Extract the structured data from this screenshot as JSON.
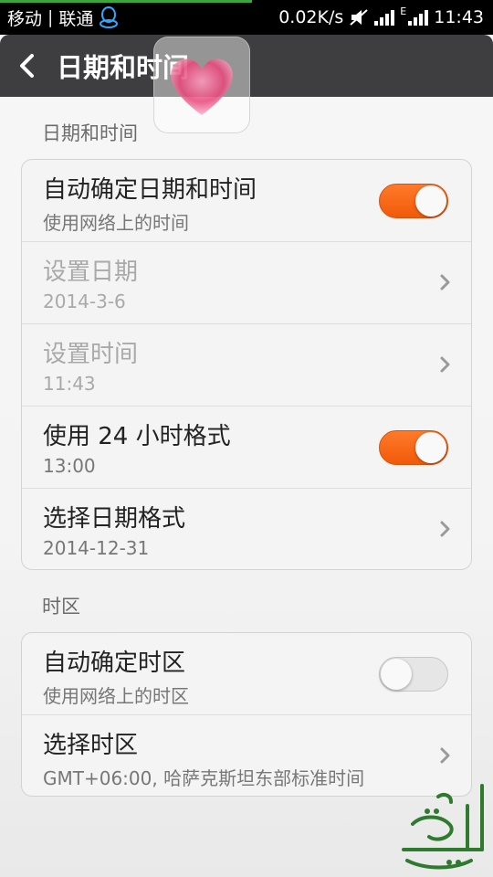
{
  "status_bar": {
    "carrier1": "移动",
    "separator": "|",
    "carrier2": "联通",
    "net_speed": "0.02K/s",
    "network_type": "E",
    "time": "11:43",
    "icons": [
      "qq-icon",
      "mute-icon",
      "signal-icon",
      "signal-icon"
    ]
  },
  "header": {
    "title": "日期和时间",
    "back_icon": "chevron-left-icon"
  },
  "sections": {
    "datetime": {
      "header": "日期和时间"
    },
    "timezone": {
      "header": "时区"
    }
  },
  "rows": {
    "auto_datetime": {
      "title": "自动确定日期和时间",
      "sub": "使用网络上的时间",
      "toggle": "on"
    },
    "set_date": {
      "title": "设置日期",
      "sub": "2014-3-6"
    },
    "set_time": {
      "title": "设置时间",
      "sub": "11:43"
    },
    "use_24h": {
      "title": "使用 24 小时格式",
      "sub": "13:00",
      "toggle": "on"
    },
    "date_format": {
      "title": "选择日期格式",
      "sub": "2014-12-31"
    },
    "auto_timezone": {
      "title": "自动确定时区",
      "sub": "使用网络上的时区",
      "toggle": "off"
    },
    "select_timezone": {
      "title": "选择时区",
      "sub": "GMT+06:00, 哈萨克斯坦东部标准时间"
    }
  },
  "colors": {
    "toggle_on": "#f26a1b",
    "action_bar": "#3e3e40",
    "accent_heart": "#e8457a"
  }
}
